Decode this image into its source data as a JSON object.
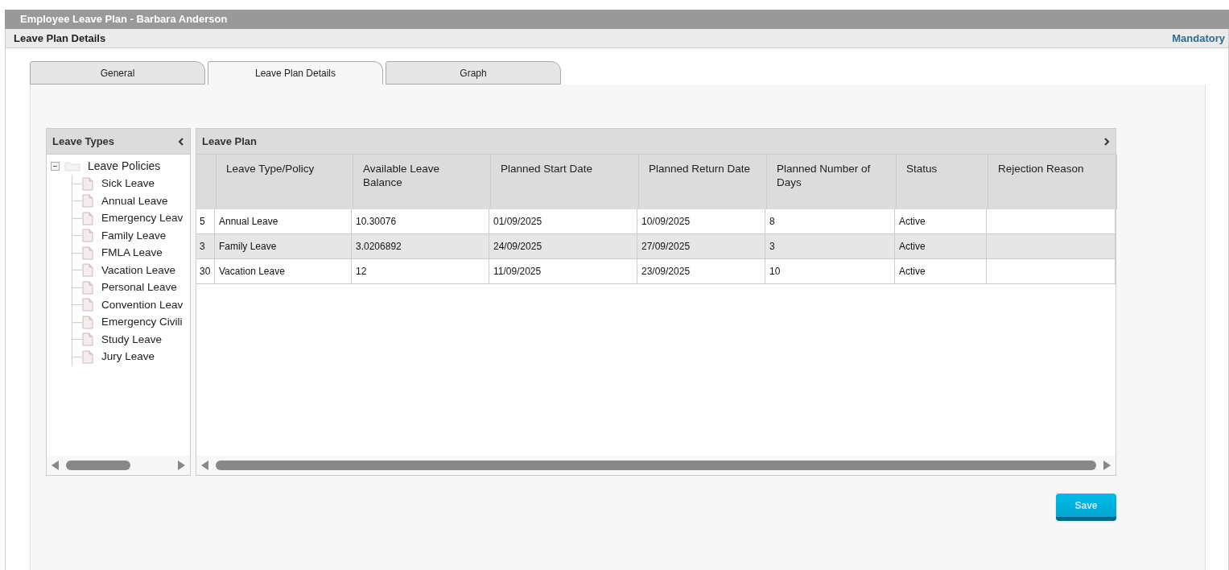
{
  "window": {
    "title": "Employee Leave Plan - Barbara Anderson"
  },
  "subheader": {
    "title": "Leave Plan Details",
    "link": "Mandatory"
  },
  "tabs": [
    {
      "label": "General",
      "selected": false
    },
    {
      "label": "Leave Plan Details",
      "selected": true
    },
    {
      "label": "Graph",
      "selected": false
    }
  ],
  "leave_types": {
    "title": "Leave Types",
    "tree": [
      {
        "label": "Leave Policies",
        "expanded": true,
        "children": [
          {
            "label": "Sick Leave"
          },
          {
            "label": "Annual Leave"
          },
          {
            "label": "Emergency Leav"
          },
          {
            "label": "Family Leave"
          },
          {
            "label": "FMLA Leave"
          },
          {
            "label": "Vacation Leave"
          },
          {
            "label": "Personal Leave"
          },
          {
            "label": "Convention Leav"
          },
          {
            "label": "Emergency Civili"
          },
          {
            "label": "Study Leave"
          },
          {
            "label": "Jury Leave"
          }
        ]
      }
    ]
  },
  "leave_plan": {
    "title": "Leave Plan",
    "columns": [
      "",
      "Leave Type/Policy",
      "Available Leave Balance",
      "Planned Start Date",
      "Planned Return Date",
      "Planned Number of Days",
      "Status",
      "Rejection Reason"
    ],
    "rows": [
      [
        "5",
        "Annual Leave",
        "10.30076",
        "01/09/2025",
        "10/09/2025",
        "8",
        "Active",
        ""
      ],
      [
        "3",
        "Family Leave",
        "3.0206892",
        "24/09/2025",
        "27/09/2025",
        "3",
        "Active",
        ""
      ],
      [
        "30",
        "Vacation Leave",
        "12",
        "11/09/2025",
        "23/09/2025",
        "10",
        "Active",
        ""
      ]
    ]
  },
  "buttons": [
    {
      "label": "Save"
    }
  ]
}
